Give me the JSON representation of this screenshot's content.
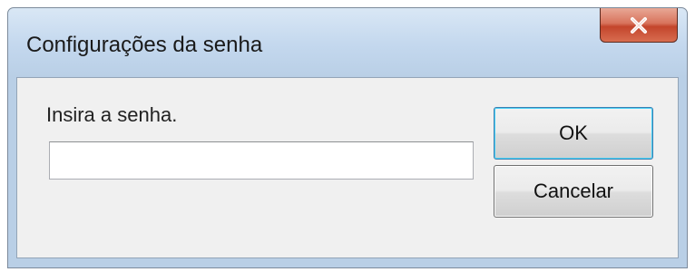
{
  "window": {
    "title": "Configurações da senha"
  },
  "titlebar": {
    "close_icon": "close-icon"
  },
  "form": {
    "prompt": "Insira a senha.",
    "password_value": ""
  },
  "buttons": {
    "ok_label": "OK",
    "cancel_label": "Cancelar"
  },
  "colors": {
    "close_button": "#c3452c",
    "default_button_border": "#3c7fb1"
  }
}
